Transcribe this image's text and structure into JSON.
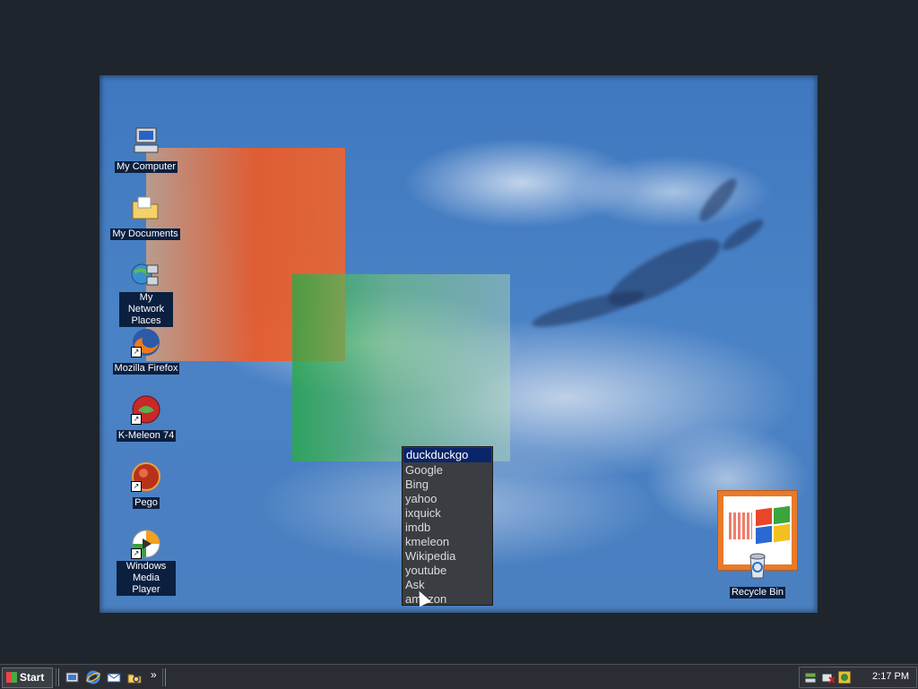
{
  "desktop": {
    "icons": [
      {
        "label": "My Computer",
        "icon": "computer-icon"
      },
      {
        "label": "My Documents",
        "icon": "folder-icon"
      },
      {
        "label": "My Network Places",
        "icon": "network-icon"
      },
      {
        "label": "Mozilla Firefox",
        "icon": "firefox-icon"
      },
      {
        "label": "K-Meleon 74",
        "icon": "kmeleon-icon"
      },
      {
        "label": "Pego",
        "icon": "pego-icon"
      },
      {
        "label": "Windows Media Player",
        "icon": "media-player-icon"
      }
    ],
    "recycle_bin": {
      "label": "Recycle Bin",
      "icon": "recycle-bin-icon"
    }
  },
  "dropdown": {
    "options": [
      "duckduckgo",
      "Google",
      "Bing",
      "yahoo",
      "ixquick",
      "imdb",
      "kmeleon",
      "Wikipedia",
      "youtube",
      "Ask",
      "amazon"
    ],
    "selected_index": 0
  },
  "taskbar": {
    "start_label": "Start",
    "quick_launch": [
      "show-desktop-icon",
      "internet-explorer-icon",
      "outlook-icon",
      "explorer-icon"
    ],
    "overflow_label": "»",
    "tray_icons": [
      "network-tray-icon",
      "security-tray-icon",
      "media-tray-icon"
    ],
    "clock": "2:17 PM"
  },
  "colors": {
    "selection": "#0a246a",
    "dropdown_bg": "#3a3d42",
    "label_bg": "#0b1f3f"
  }
}
